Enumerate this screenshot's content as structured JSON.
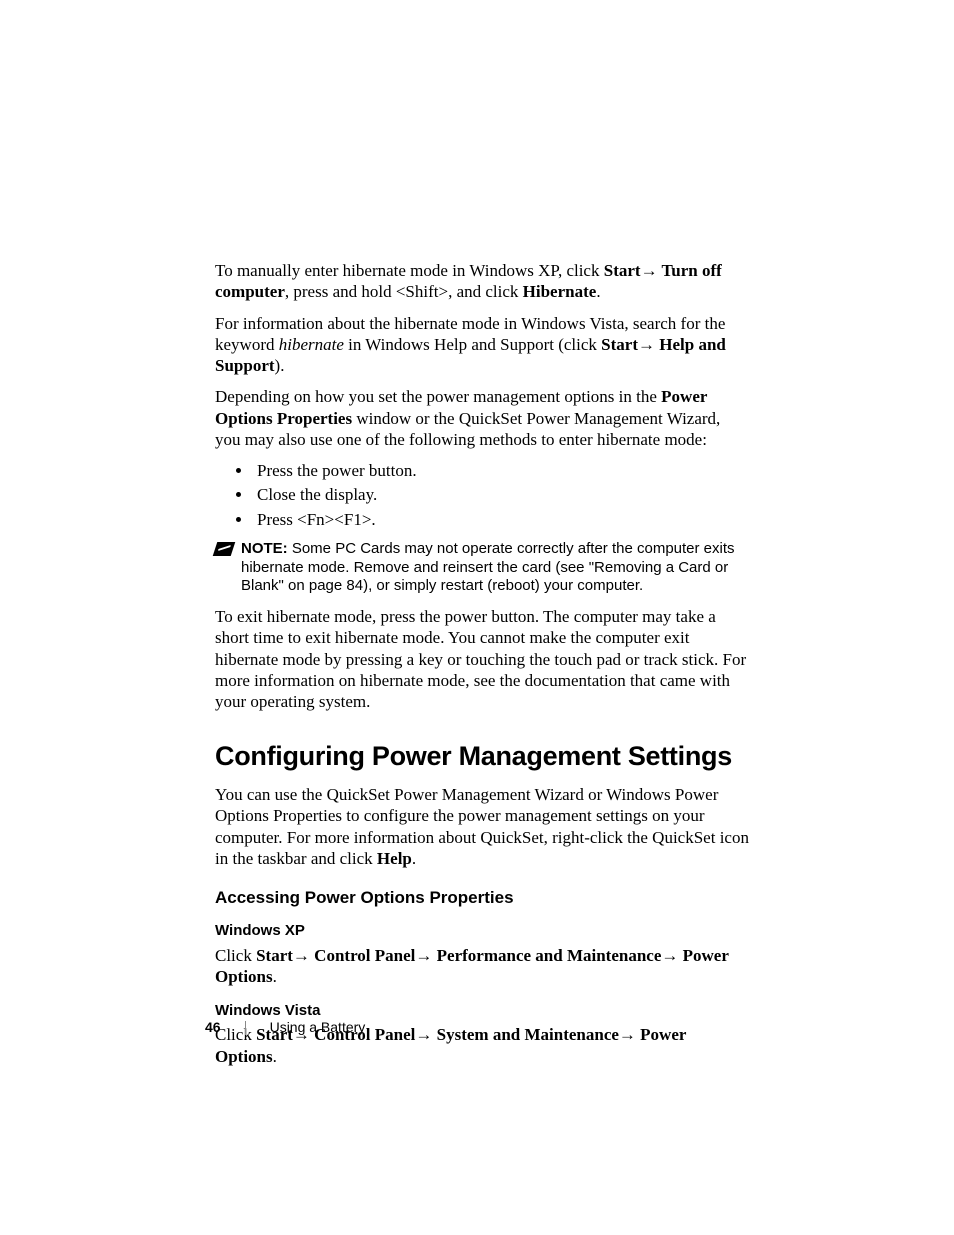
{
  "paragraphs": {
    "p1_a": "To manually enter hibernate mode in Windows XP, click ",
    "p1_b": "Start",
    "p1_arrow": "→ ",
    "p1_c": "Turn off computer",
    "p1_d": ", press and hold <Shift>, and click ",
    "p1_e": "Hibernate",
    "p1_f": ".",
    "p2_a": "For information about the hibernate mode in Windows Vista, search for the keyword ",
    "p2_b": "hibernate",
    "p2_c": " in Windows Help and Support (click ",
    "p2_d": "Start",
    "p2_e": "Help and Support",
    "p2_f": ").",
    "p3_a": "Depending on how you set the power management options in the ",
    "p3_b": "Power Options Properties",
    "p3_c": " window or the QuickSet Power Management Wizard, you may also use one of the following methods to enter hibernate mode:",
    "p4": "To exit hibernate mode, press the power button. The computer may take a short time to exit hibernate mode. You cannot make the computer exit hibernate mode by pressing a key or touching the touch pad or track stick. For more information on hibernate mode, see the documentation that came with your operating system.",
    "p5_a": "You can use the QuickSet Power Management Wizard or Windows Power Options Properties to configure the power management settings on your computer. For more information about QuickSet, right-click the QuickSet icon in the taskbar and click ",
    "p5_b": "Help",
    "p5_c": ".",
    "xp_a": "Click ",
    "xp_b": "Start",
    "xp_c": "Control Panel",
    "xp_d": "Performance and Maintenance",
    "xp_e": "Power Options",
    "xp_f": ".",
    "vista_a": "Click ",
    "vista_b": "Start",
    "vista_c": "Control Panel",
    "vista_d": "System and Maintenance",
    "vista_e": "Power Options",
    "vista_f": "."
  },
  "bullets": [
    "Press the power button.",
    "Close the display.",
    "Press <Fn><F1>."
  ],
  "note": {
    "label": "NOTE:",
    "text": " Some PC Cards may not operate correctly after the computer exits hibernate mode. Remove and reinsert the card (see \"Removing a Card or Blank\" on page 84), or simply restart (reboot) your computer."
  },
  "headings": {
    "h1": "Configuring Power Management Settings",
    "h2": "Accessing Power Options Properties",
    "xp": "Windows XP",
    "vista": "Windows Vista"
  },
  "footer": {
    "page": "46",
    "section": "Using a Battery"
  },
  "arrow": "→ "
}
